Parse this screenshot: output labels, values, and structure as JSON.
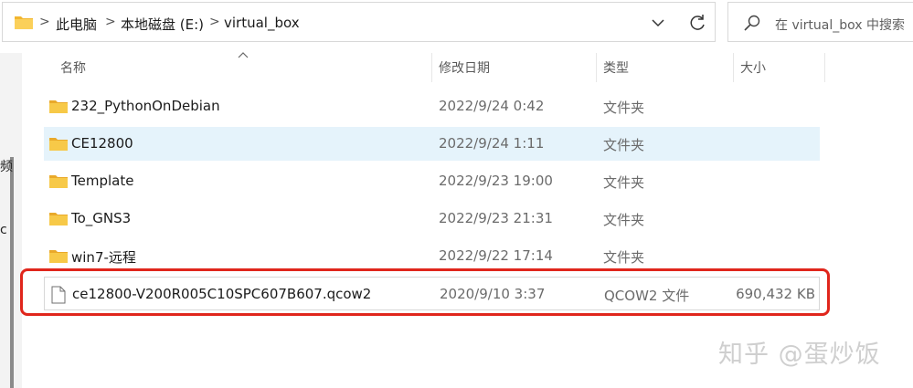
{
  "address_bar": {
    "crumbs": [
      "此电脑",
      "本地磁盘 (E:)",
      "virtual_box"
    ],
    "separator": ">"
  },
  "search": {
    "placeholder": "在 virtual_box 中搜索"
  },
  "nav_fragments": [
    "频",
    "c"
  ],
  "columns": {
    "name": "名称",
    "date": "修改日期",
    "type": "类型",
    "size": "大小"
  },
  "files": [
    {
      "name": "232_PythonOnDebian",
      "date": "2022/9/24 0:42",
      "type": "文件夹",
      "size": "",
      "kind": "folder"
    },
    {
      "name": "CE12800",
      "date": "2022/9/24 1:11",
      "type": "文件夹",
      "size": "",
      "kind": "folder",
      "selected": true
    },
    {
      "name": "Template",
      "date": "2022/9/23 19:00",
      "type": "文件夹",
      "size": "",
      "kind": "folder"
    },
    {
      "name": "To_GNS3",
      "date": "2022/9/23 21:31",
      "type": "文件夹",
      "size": "",
      "kind": "folder"
    },
    {
      "name": "win7-远程",
      "date": "2022/9/22 17:14",
      "type": "文件夹",
      "size": "",
      "kind": "folder"
    },
    {
      "name": "ce12800-V200R005C10SPC607B607.qcow2",
      "date": "2020/9/10 3:37",
      "type": "QCOW2 文件",
      "size": "690,432 KB",
      "kind": "file",
      "highlighted": true
    }
  ],
  "watermark": "知乎 @蛋炒饭",
  "colors": {
    "highlight": "#e0261c",
    "selection": "#e5f3fb",
    "folder": "#f5c342"
  }
}
